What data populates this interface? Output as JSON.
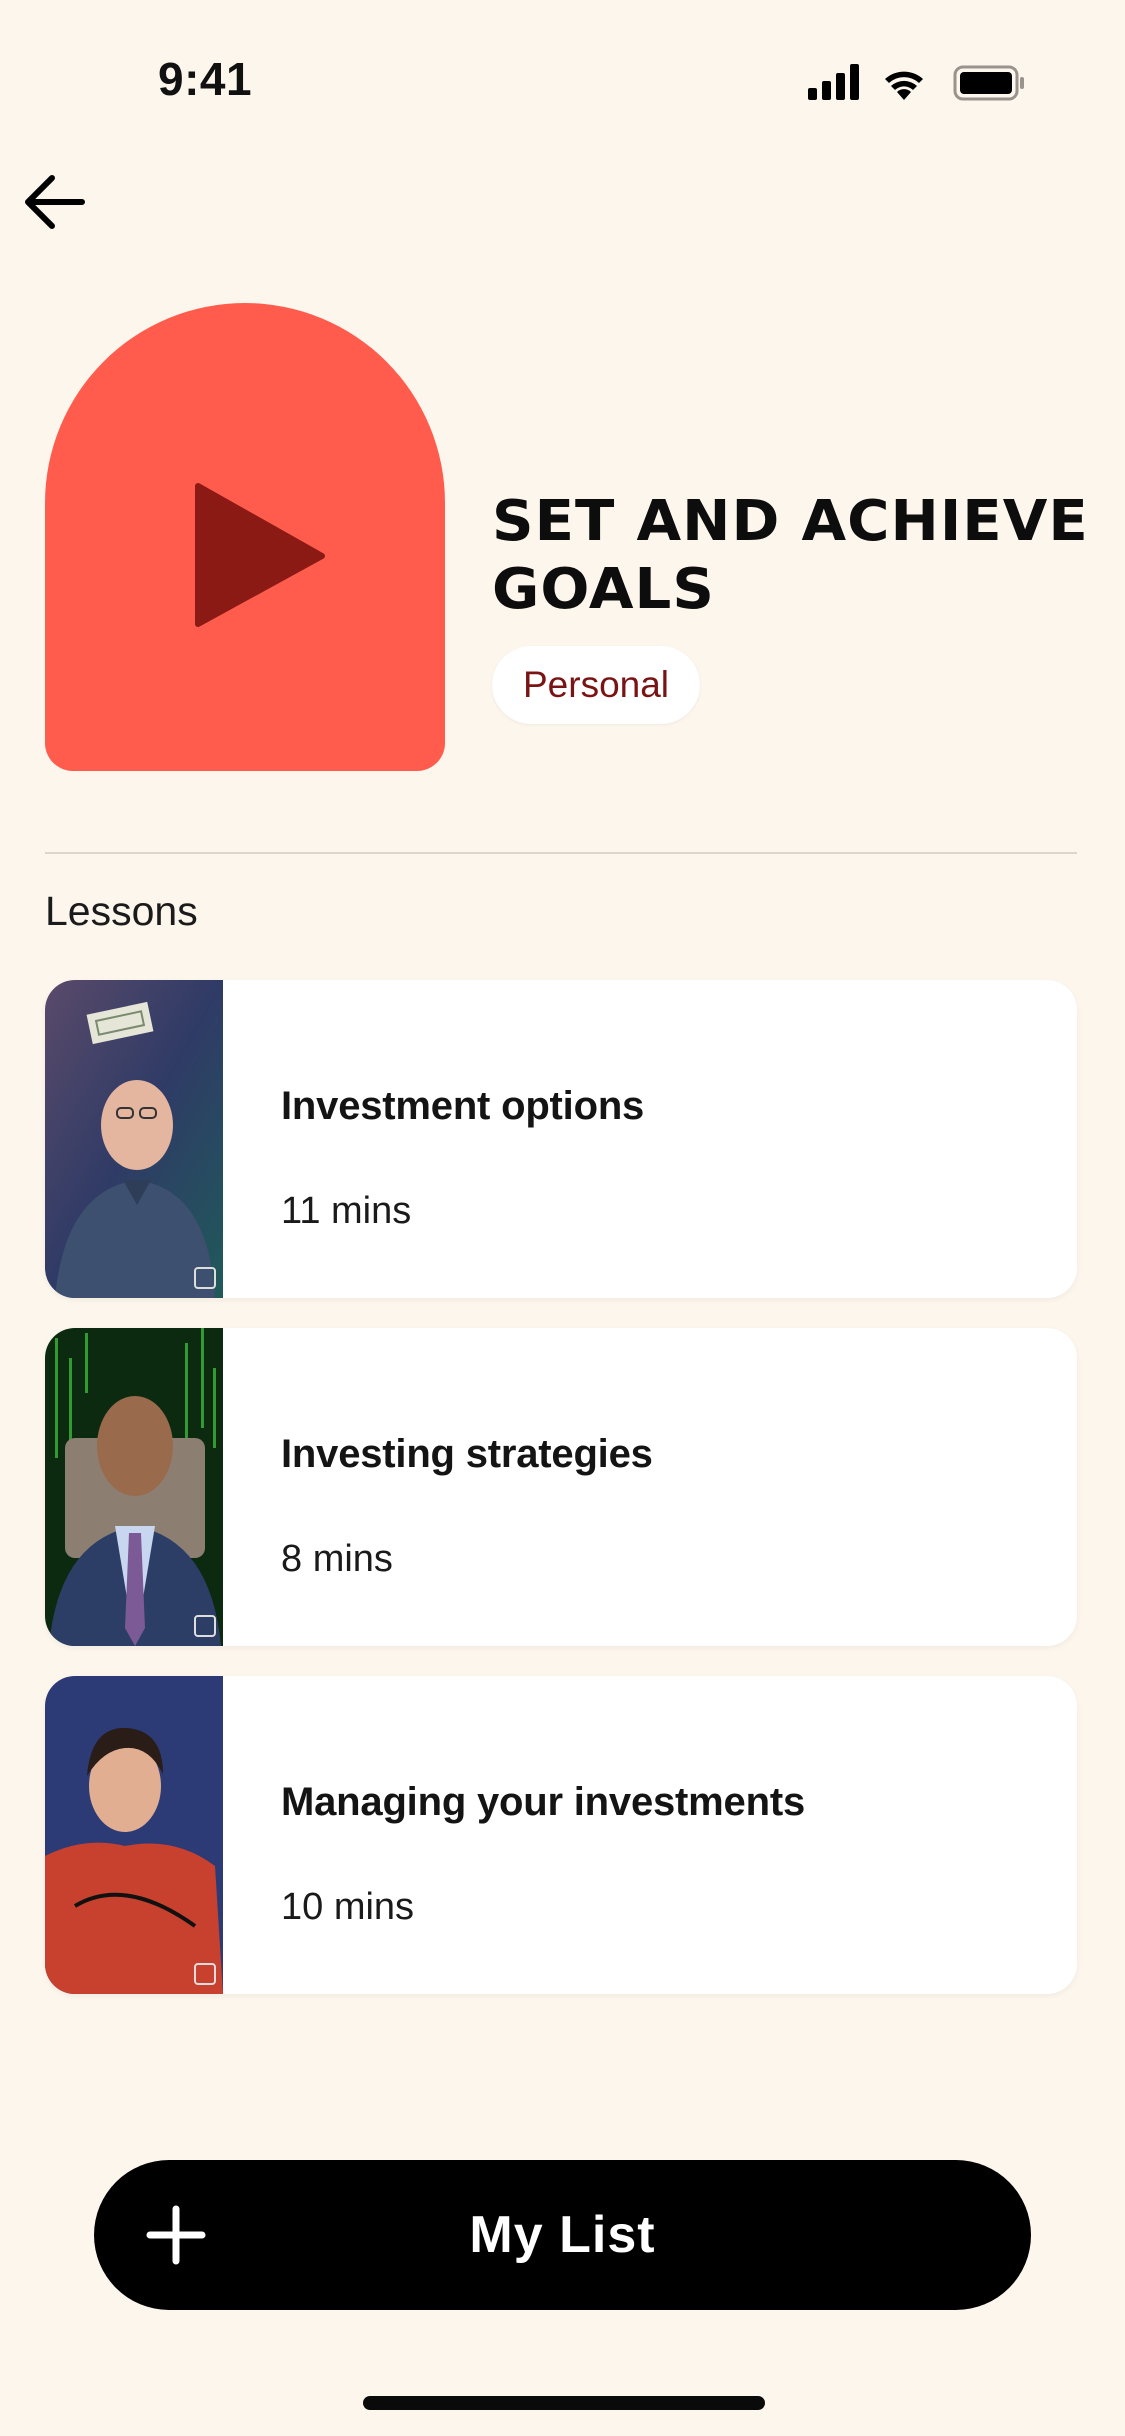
{
  "status_bar": {
    "time": "9:41",
    "icons": [
      "signal-icon",
      "wifi-icon",
      "battery-icon"
    ]
  },
  "nav": {
    "back_icon": "arrow-left-icon"
  },
  "course": {
    "title": "Set and achieve goals",
    "tag": "Personal",
    "art_color": "#ff5c4d",
    "play_color": "#8b1a14"
  },
  "lessons": {
    "section_title": "Lessons",
    "items": [
      {
        "title": "Investment options",
        "duration": "11 mins"
      },
      {
        "title": "Investing strategies",
        "duration": "8 mins"
      },
      {
        "title": "Managing your investments",
        "duration": "10 mins"
      }
    ]
  },
  "cta": {
    "label": "My List",
    "icon": "plus-icon"
  },
  "colors": {
    "background": "#fdf6ec",
    "accent": "#ff5c4d",
    "tag_text": "#7a1414",
    "cta_bg": "#000000"
  }
}
